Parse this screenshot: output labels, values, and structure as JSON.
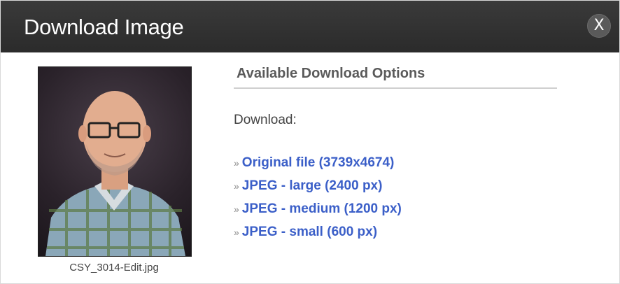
{
  "dialog": {
    "title": "Download Image",
    "close_label": "X"
  },
  "image": {
    "filename": "CSY_3014-Edit.jpg"
  },
  "options_panel": {
    "heading": "Available Download Options",
    "download_label": "Download:",
    "bullet": "»",
    "items": [
      {
        "label": "Original file (3739x4674)"
      },
      {
        "label": "JPEG - large (2400 px)"
      },
      {
        "label": "JPEG - medium (1200 px)"
      },
      {
        "label": "JPEG - small (600 px)"
      }
    ]
  },
  "colors": {
    "titlebar": "#2f2f2f",
    "link": "#3b5fc8"
  }
}
